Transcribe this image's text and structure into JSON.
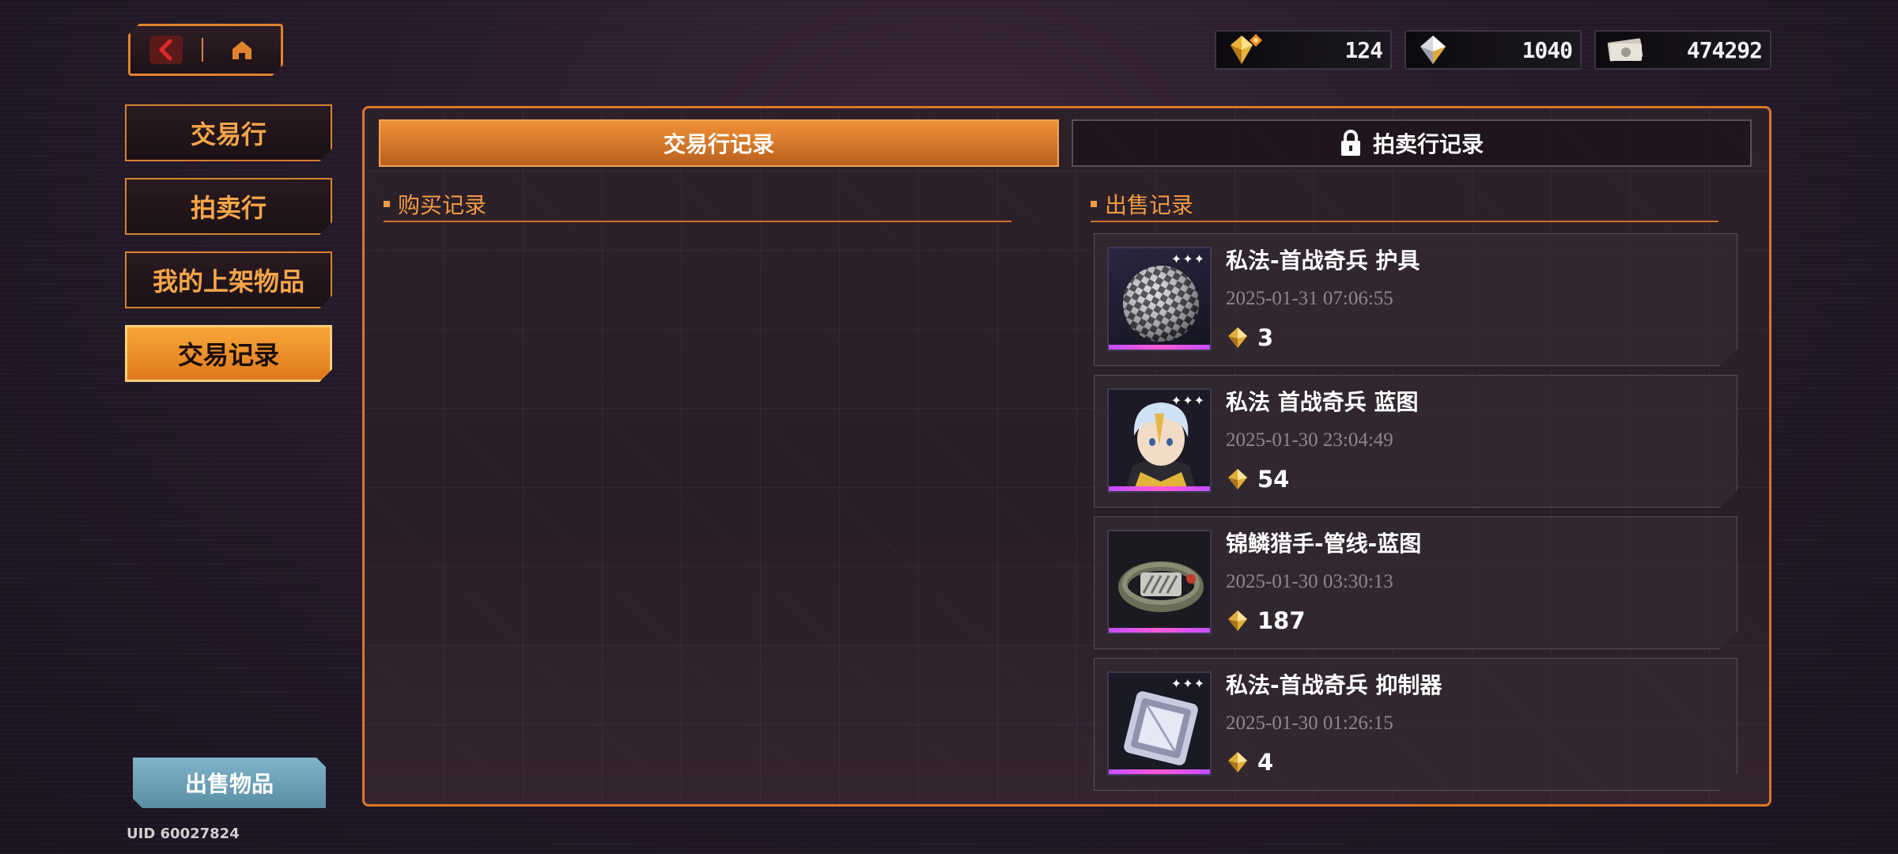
{
  "currencies": [
    {
      "icon": "premium-gem-icon",
      "value": "124"
    },
    {
      "icon": "gem-icon",
      "value": "1040"
    },
    {
      "icon": "cash-icon",
      "value": "474292"
    }
  ],
  "sidebar": {
    "items": [
      {
        "label": "交易行",
        "active": false
      },
      {
        "label": "拍卖行",
        "active": false
      },
      {
        "label": "我的上架物品",
        "active": false
      },
      {
        "label": "交易记录",
        "active": true
      }
    ],
    "sell_button": "出售物品",
    "uid": "UID 60027824"
  },
  "tabs": [
    {
      "label": "交易行记录",
      "active": true
    },
    {
      "label": "拍卖行记录",
      "active": false,
      "icon": "lock-icon"
    }
  ],
  "purchase": {
    "heading": "购买记录"
  },
  "sales": {
    "heading": "出售记录",
    "records": [
      {
        "name": "私法-首战奇兵 护具",
        "time": "2025-01-31 07:06:55",
        "price": "3",
        "icon": "armor-orb-icon"
      },
      {
        "name": "私法 首战奇兵 蓝图",
        "time": "2025-01-30 23:04:49",
        "price": "54",
        "icon": "character-portrait-icon"
      },
      {
        "name": "锦鳞猎手-管线-蓝图",
        "time": "2025-01-30 03:30:13",
        "price": "187",
        "icon": "cable-coil-icon"
      },
      {
        "name": "私法-首战奇兵 抑制器",
        "time": "2025-01-30 01:26:15",
        "price": "4",
        "icon": "crystal-cube-icon"
      }
    ]
  },
  "colors": {
    "accent": "#e0832a",
    "active_tab": "#f09035",
    "rarity": "#c44dff",
    "gold_price": "#d9a93a"
  }
}
